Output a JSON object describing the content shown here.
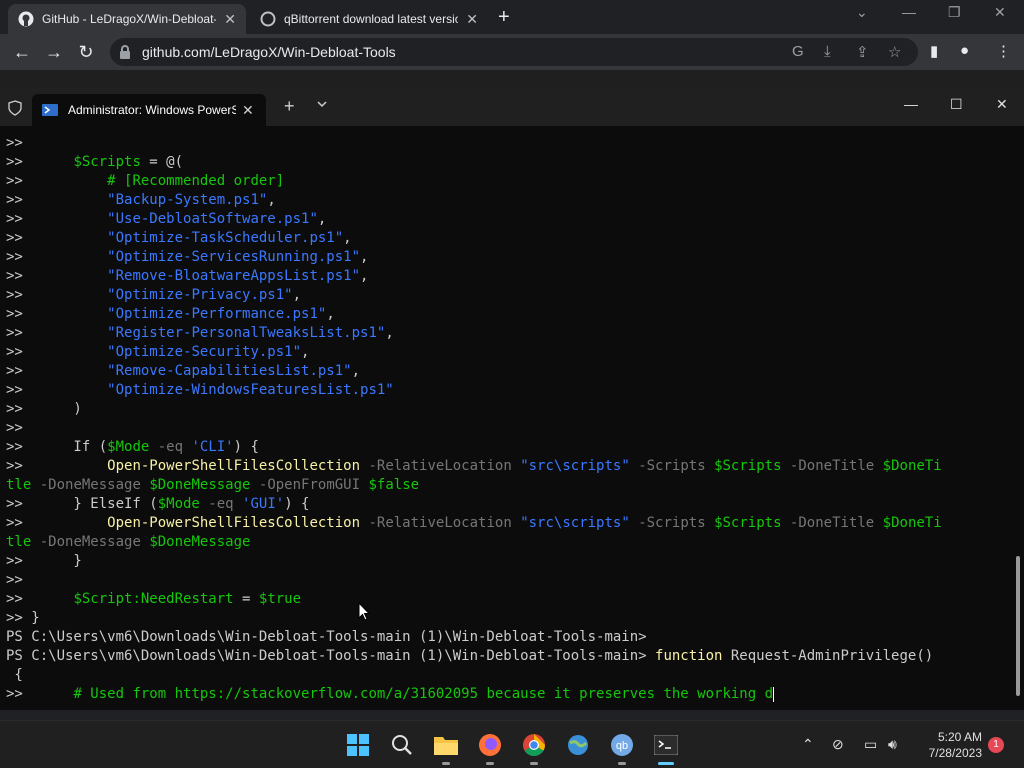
{
  "browser": {
    "tabs": [
      {
        "title": "GitHub - LeDragoX/Win-Debloat-Tools",
        "favicon": "github-icon"
      },
      {
        "title": "qBittorrent download latest version",
        "favicon": "globe-icon"
      }
    ],
    "url": "github.com/LeDragoX/Win-Debloat-Tools"
  },
  "terminal": {
    "tab_title": "Administrator: Windows PowerShell",
    "lines": [
      [
        {
          "t": ">>",
          "c": "pp"
        }
      ],
      [
        {
          "t": ">>      ",
          "c": "pp"
        },
        {
          "t": "$Scripts",
          "c": "v"
        },
        {
          "t": " = @(",
          "c": "pp"
        }
      ],
      [
        {
          "t": ">>          ",
          "c": "pp"
        },
        {
          "t": "# [Recommended order]",
          "c": "c"
        }
      ],
      [
        {
          "t": ">>          ",
          "c": "pp"
        },
        {
          "t": "\"Backup-System.ps1\"",
          "c": "s"
        },
        {
          "t": ",",
          "c": "pp"
        }
      ],
      [
        {
          "t": ">>          ",
          "c": "pp"
        },
        {
          "t": "\"Use-DebloatSoftware.ps1\"",
          "c": "s"
        },
        {
          "t": ",",
          "c": "pp"
        }
      ],
      [
        {
          "t": ">>          ",
          "c": "pp"
        },
        {
          "t": "\"Optimize-TaskScheduler.ps1\"",
          "c": "s"
        },
        {
          "t": ",",
          "c": "pp"
        }
      ],
      [
        {
          "t": ">>          ",
          "c": "pp"
        },
        {
          "t": "\"Optimize-ServicesRunning.ps1\"",
          "c": "s"
        },
        {
          "t": ",",
          "c": "pp"
        }
      ],
      [
        {
          "t": ">>          ",
          "c": "pp"
        },
        {
          "t": "\"Remove-BloatwareAppsList.ps1\"",
          "c": "s"
        },
        {
          "t": ",",
          "c": "pp"
        }
      ],
      [
        {
          "t": ">>          ",
          "c": "pp"
        },
        {
          "t": "\"Optimize-Privacy.ps1\"",
          "c": "s"
        },
        {
          "t": ",",
          "c": "pp"
        }
      ],
      [
        {
          "t": ">>          ",
          "c": "pp"
        },
        {
          "t": "\"Optimize-Performance.ps1\"",
          "c": "s"
        },
        {
          "t": ",",
          "c": "pp"
        }
      ],
      [
        {
          "t": ">>          ",
          "c": "pp"
        },
        {
          "t": "\"Register-PersonalTweaksList.ps1\"",
          "c": "s"
        },
        {
          "t": ",",
          "c": "pp"
        }
      ],
      [
        {
          "t": ">>          ",
          "c": "pp"
        },
        {
          "t": "\"Optimize-Security.ps1\"",
          "c": "s"
        },
        {
          "t": ",",
          "c": "pp"
        }
      ],
      [
        {
          "t": ">>          ",
          "c": "pp"
        },
        {
          "t": "\"Remove-CapabilitiesList.ps1\"",
          "c": "s"
        },
        {
          "t": ",",
          "c": "pp"
        }
      ],
      [
        {
          "t": ">>          ",
          "c": "pp"
        },
        {
          "t": "\"Optimize-WindowsFeaturesList.ps1\"",
          "c": "s"
        }
      ],
      [
        {
          "t": ">>      )",
          "c": "pp"
        }
      ],
      [
        {
          "t": ">>",
          "c": "pp"
        }
      ],
      [
        {
          "t": ">>      If (",
          "c": "pp"
        },
        {
          "t": "$Mode",
          "c": "v"
        },
        {
          "t": " -eq ",
          "c": "op"
        },
        {
          "t": "'CLI'",
          "c": "s"
        },
        {
          "t": ") {",
          "c": "pp"
        }
      ],
      [
        {
          "t": ">>          ",
          "c": "pp"
        },
        {
          "t": "Open-PowerShellFilesCollection",
          "c": "fn"
        },
        {
          "t": " -RelativeLocation ",
          "c": "op"
        },
        {
          "t": "\"src\\scripts\"",
          "c": "s"
        },
        {
          "t": " -Scripts ",
          "c": "op"
        },
        {
          "t": "$Scripts",
          "c": "v"
        },
        {
          "t": " -DoneTitle ",
          "c": "op"
        },
        {
          "t": "$DoneTi",
          "c": "v"
        }
      ],
      [
        {
          "t": "tle",
          "c": "v"
        },
        {
          "t": " -DoneMessage ",
          "c": "op"
        },
        {
          "t": "$DoneMessage",
          "c": "v"
        },
        {
          "t": " -OpenFromGUI ",
          "c": "op"
        },
        {
          "t": "$false",
          "c": "v"
        }
      ],
      [
        {
          "t": ">>      } ElseIf (",
          "c": "pp"
        },
        {
          "t": "$Mode",
          "c": "v"
        },
        {
          "t": " -eq ",
          "c": "op"
        },
        {
          "t": "'GUI'",
          "c": "s"
        },
        {
          "t": ") {",
          "c": "pp"
        }
      ],
      [
        {
          "t": ">>          ",
          "c": "pp"
        },
        {
          "t": "Open-PowerShellFilesCollection",
          "c": "fn"
        },
        {
          "t": " -RelativeLocation ",
          "c": "op"
        },
        {
          "t": "\"src\\scripts\"",
          "c": "s"
        },
        {
          "t": " -Scripts ",
          "c": "op"
        },
        {
          "t": "$Scripts",
          "c": "v"
        },
        {
          "t": " -DoneTitle ",
          "c": "op"
        },
        {
          "t": "$DoneTi",
          "c": "v"
        }
      ],
      [
        {
          "t": "tle",
          "c": "v"
        },
        {
          "t": " -DoneMessage ",
          "c": "op"
        },
        {
          "t": "$DoneMessage",
          "c": "v"
        }
      ],
      [
        {
          "t": ">>      }",
          "c": "pp"
        }
      ],
      [
        {
          "t": ">>",
          "c": "pp"
        }
      ],
      [
        {
          "t": ">>      ",
          "c": "pp"
        },
        {
          "t": "$Script:NeedRestart",
          "c": "v"
        },
        {
          "t": " = ",
          "c": "pp"
        },
        {
          "t": "$true",
          "c": "v"
        }
      ],
      [
        {
          "t": ">> }",
          "c": "pp"
        }
      ],
      [
        {
          "t": "PS C:\\Users\\vm6\\Downloads\\Win-Debloat-Tools-main (1)\\Win-Debloat-Tools-main>",
          "c": "pp"
        }
      ],
      [
        {
          "t": "PS C:\\Users\\vm6\\Downloads\\Win-Debloat-Tools-main (1)\\Win-Debloat-Tools-main> ",
          "c": "pp"
        },
        {
          "t": "function",
          "c": "fn"
        },
        {
          "t": " Request-AdminPrivilege()",
          "c": "pp"
        }
      ],
      [
        {
          "t": " {",
          "c": "pp"
        }
      ],
      [
        {
          "t": ">>      ",
          "c": "pp"
        },
        {
          "t": "# Used from https://stackoverflow.com/a/31602095 because it preserves the working d",
          "c": "c"
        }
      ]
    ]
  },
  "taskbar": {
    "apps": [
      "start-icon",
      "search-icon",
      "file-explorer-icon",
      "firefox-icon",
      "chrome-icon",
      "globe-app-icon",
      "qbittorrent-icon",
      "terminal-icon"
    ],
    "qbittorrent_label": "qb",
    "time": "5:20 AM",
    "date": "7/28/2023",
    "notification_count": "1"
  }
}
